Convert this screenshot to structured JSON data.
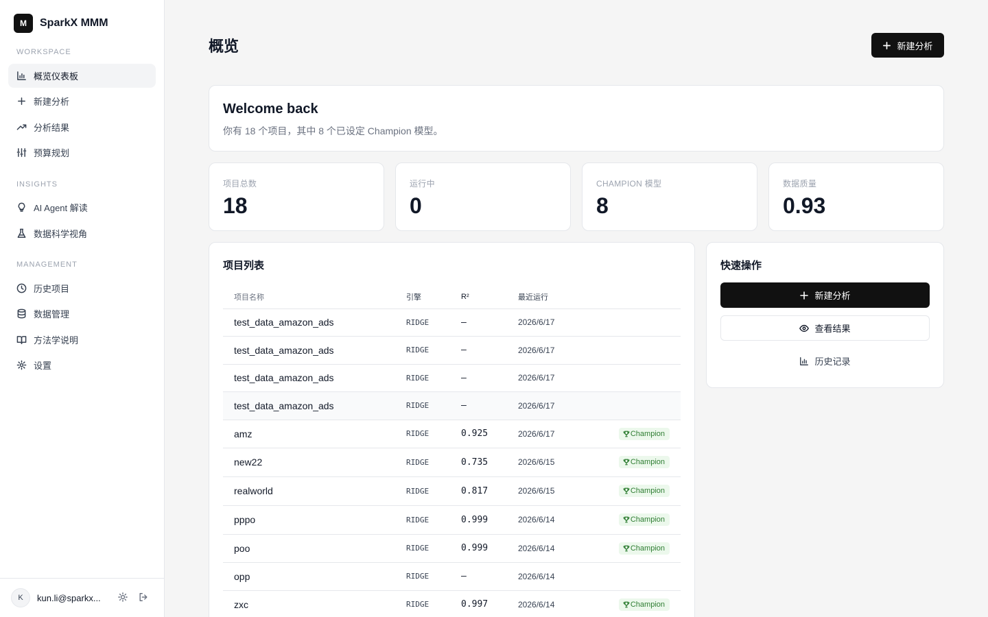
{
  "brand": {
    "logo_letter": "M",
    "name": "SparkX MMM"
  },
  "sidebar": {
    "sections": [
      {
        "label": "WORKSPACE",
        "items": [
          {
            "label": "概览仪表板",
            "icon": "bar-chart-icon",
            "active": true
          },
          {
            "label": "新建分析",
            "icon": "plus-icon"
          },
          {
            "label": "分析结果",
            "icon": "trending-up-icon"
          },
          {
            "label": "预算规划",
            "icon": "sliders-icon"
          }
        ]
      },
      {
        "label": "INSIGHTS",
        "items": [
          {
            "label": "AI Agent 解读",
            "icon": "lightbulb-icon"
          },
          {
            "label": "数据科学视角",
            "icon": "flask-icon"
          }
        ]
      },
      {
        "label": "MANAGEMENT",
        "items": [
          {
            "label": "历史项目",
            "icon": "clock-icon"
          },
          {
            "label": "数据管理",
            "icon": "database-icon"
          },
          {
            "label": "方法学说明",
            "icon": "book-icon"
          },
          {
            "label": "设置",
            "icon": "gear-icon"
          }
        ]
      }
    ]
  },
  "user": {
    "avatar_letter": "K",
    "email": "kun.li@sparkx..."
  },
  "header": {
    "title": "概览",
    "new_button": "新建分析"
  },
  "welcome": {
    "title": "Welcome back",
    "subtitle": "你有 18 个项目，其中 8 个已设定 Champion 模型。"
  },
  "stats": [
    {
      "label": "项目总数",
      "value": "18"
    },
    {
      "label": "运行中",
      "value": "0"
    },
    {
      "label": "CHAMPION 模型",
      "value": "8"
    },
    {
      "label": "数据质量",
      "value": "0.93"
    }
  ],
  "projects": {
    "title": "项目列表",
    "columns": [
      "项目名称",
      "引擎",
      "R²",
      "最近运行",
      ""
    ],
    "rows": [
      {
        "name": "test_data_amazon_ads",
        "engine": "RIDGE",
        "r2": "—",
        "date": "2026/6/17",
        "badge": ""
      },
      {
        "name": "test_data_amazon_ads",
        "engine": "RIDGE",
        "r2": "—",
        "date": "2026/6/17",
        "badge": ""
      },
      {
        "name": "test_data_amazon_ads",
        "engine": "RIDGE",
        "r2": "—",
        "date": "2026/6/17",
        "badge": ""
      },
      {
        "name": "test_data_amazon_ads",
        "engine": "RIDGE",
        "r2": "—",
        "date": "2026/6/17",
        "badge": "",
        "highlight": true
      },
      {
        "name": "amz",
        "engine": "RIDGE",
        "r2": "0.925",
        "date": "2026/6/17",
        "badge": "Champion"
      },
      {
        "name": "new22",
        "engine": "RIDGE",
        "r2": "0.735",
        "date": "2026/6/15",
        "badge": "Champion"
      },
      {
        "name": "realworld",
        "engine": "RIDGE",
        "r2": "0.817",
        "date": "2026/6/15",
        "badge": "Champion"
      },
      {
        "name": "pppo",
        "engine": "RIDGE",
        "r2": "0.999",
        "date": "2026/6/14",
        "badge": "Champion"
      },
      {
        "name": "poo",
        "engine": "RIDGE",
        "r2": "0.999",
        "date": "2026/6/14",
        "badge": "Champion"
      },
      {
        "name": "opp",
        "engine": "RIDGE",
        "r2": "—",
        "date": "2026/6/14",
        "badge": ""
      },
      {
        "name": "zxc",
        "engine": "RIDGE",
        "r2": "0.997",
        "date": "2026/6/14",
        "badge": "Champion"
      }
    ]
  },
  "quick_actions": {
    "title": "快速操作",
    "new_analysis": "新建分析",
    "view_results": "查看结果",
    "history": "历史记录"
  }
}
